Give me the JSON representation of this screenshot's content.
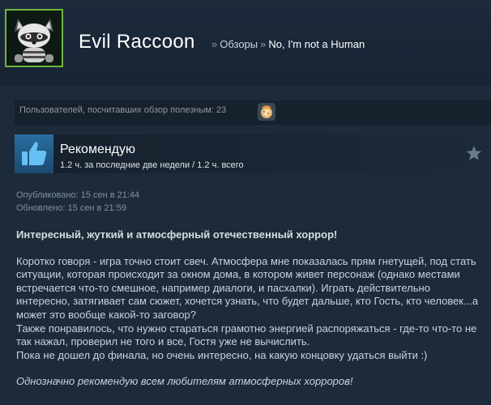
{
  "header": {
    "profile_name": "Evil Raccoon",
    "breadcrumb_section": "Обзоры",
    "breadcrumb_game": "No, I'm not a Human",
    "separator": "»"
  },
  "helpful": {
    "text": "Пользователей, посчитавших обзор полезным: 23",
    "award_icon": "award-icon"
  },
  "verdict": {
    "title": "Рекомендую",
    "playtime": "1.2 ч. за последние две недели / 1.2 ч. всего",
    "icon": "thumbs-up-icon"
  },
  "dates": {
    "posted": "Опубликовано: 15 сен в 21:44",
    "updated": "Обновлено: 15 сен в 21:59"
  },
  "review": {
    "title": "Интересный, жуткий и атмосферный отечественный хоррор!",
    "p1": "Коротко говоря - игра точно стоит свеч. Атмосфера мне показалась прям гнетущей, под стать ситуации, которая происходит за окном дома, в котором живет персонаж (однако местами встречается что-то смешное, например диалоги, и пасхалки). Играть действительно интересно, затягивает сам сюжет, хочется узнать, что будет дальше, кто Гость, кто человек...а может это вообще какой-то заговор?",
    "p2": "Также понравилось, что нужно стараться грамотно энергией распоряжаться - где-то что-то не так нажал, проверил не того и все, Гостя уже не вычислить.",
    "p3": "Пока не дошел до финала, но очень интересно, на какую концовку удаться выйти :)",
    "final": "Однозначно рекомендую всем любителям атмосферных хорроров!"
  },
  "colors": {
    "background": "#1b2838",
    "accent_blue": "#2a6e9e",
    "avatar_frame": "#6db63f"
  }
}
